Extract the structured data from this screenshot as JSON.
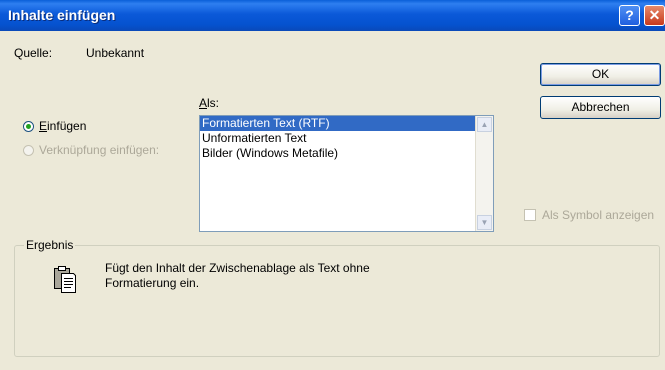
{
  "window": {
    "title": "Inhalte einfügen",
    "help_glyph": "?",
    "close_glyph": "✕"
  },
  "source": {
    "label": "Quelle:",
    "value": "Unbekannt"
  },
  "buttons": {
    "ok": "OK",
    "cancel": "Abbrechen"
  },
  "as_label": "Als:",
  "options": {
    "paste": {
      "label": "Einfügen",
      "checked": true
    },
    "paste_link": {
      "label": "Verknüpfung einfügen:",
      "enabled": false
    }
  },
  "list": {
    "items": [
      "Formatierten Text (RTF)",
      "Unformatierten Text",
      "Bilder (Windows Metafile)"
    ],
    "selected_index": 0
  },
  "show_as_icon": {
    "label": "Als Symbol anzeigen",
    "enabled": false,
    "checked": false
  },
  "result": {
    "title": "Ergebnis",
    "line1": "Fügt den Inhalt der Zwischenablage als Text ohne",
    "line2": "Formatierung ein."
  },
  "icons": [
    "help-icon",
    "close-icon",
    "clipboard-icon",
    "scroll-up-icon",
    "scroll-down-icon"
  ],
  "colors": {
    "titlebar": "#0552cf",
    "dialog_bg": "#ece9d8",
    "selection": "#316ac5",
    "radio_dot": "#21a121"
  }
}
